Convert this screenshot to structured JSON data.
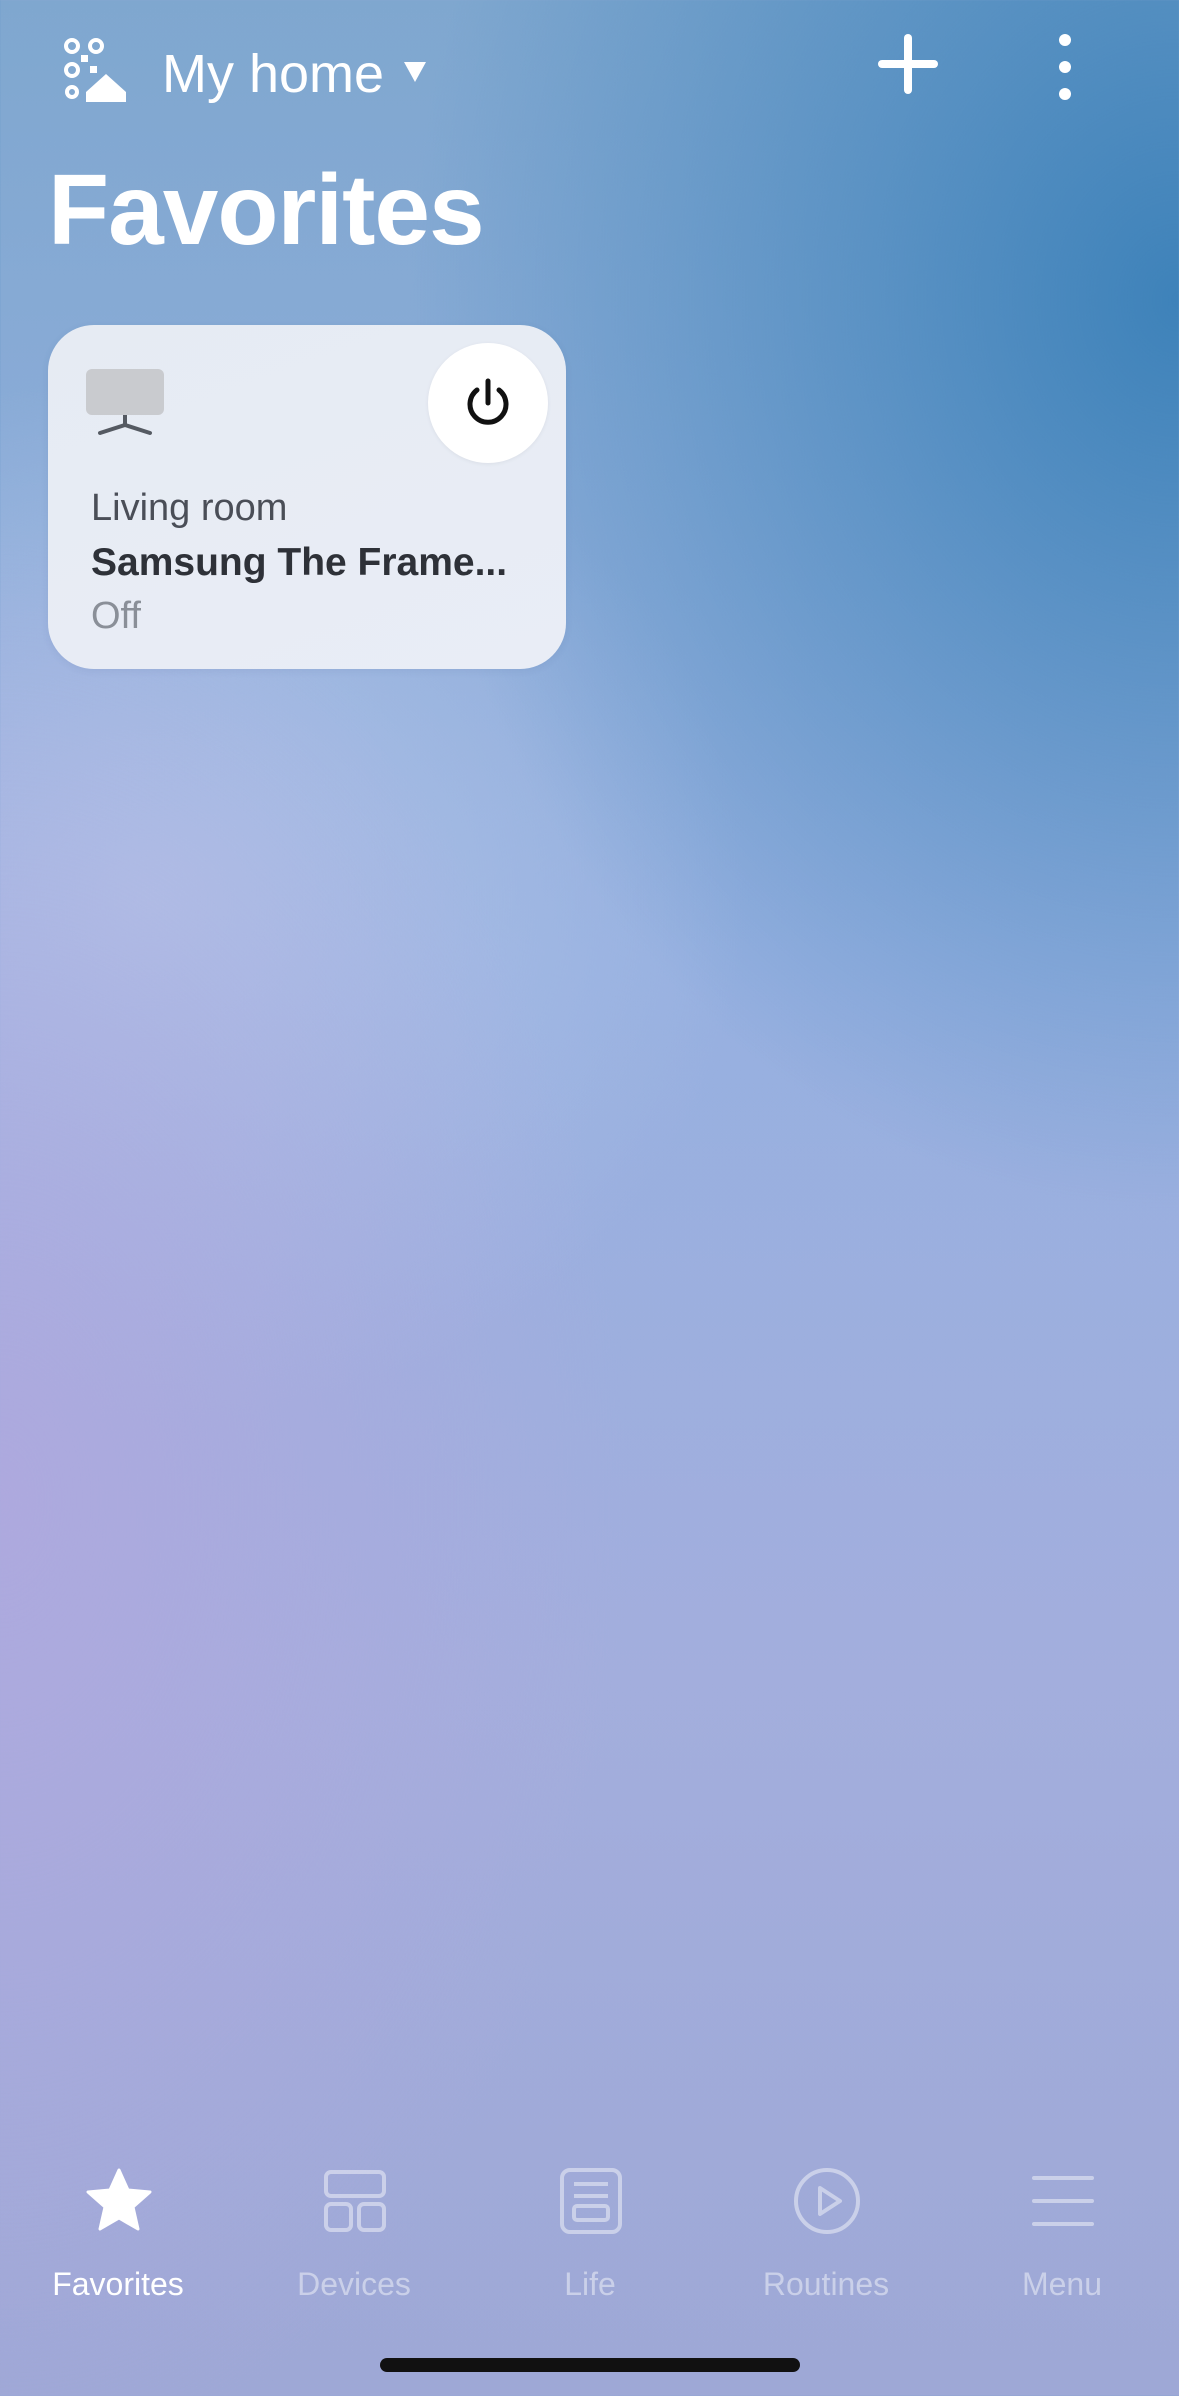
{
  "header": {
    "home_name": "My home",
    "add_icon": "plus-icon",
    "more_icon": "more-vertical-icon",
    "home_icon": "qr-home-icon"
  },
  "page": {
    "title": "Favorites"
  },
  "favorites": [
    {
      "room": "Living room",
      "name": "Samsung The Frame...",
      "status": "Off",
      "device_icon": "tv-icon",
      "action_icon": "power-icon"
    }
  ],
  "bottom_nav": {
    "items": [
      {
        "label": "Favorites",
        "icon": "star-icon",
        "active": true
      },
      {
        "label": "Devices",
        "icon": "devices-grid-icon",
        "active": false
      },
      {
        "label": "Life",
        "icon": "life-icon",
        "active": false
      },
      {
        "label": "Routines",
        "icon": "play-circle-icon",
        "active": false
      },
      {
        "label": "Menu",
        "icon": "menu-icon",
        "active": false
      }
    ]
  },
  "colors": {
    "text_primary": "#ffffff",
    "nav_inactive": "#c8d2ea",
    "card_bg": "#e7ecf4"
  }
}
